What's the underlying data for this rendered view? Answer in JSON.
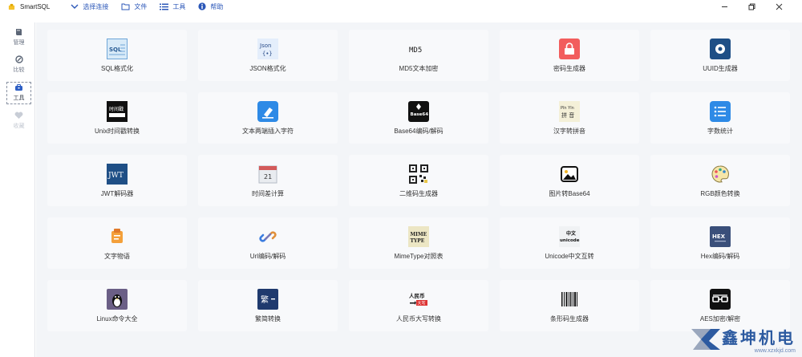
{
  "titlebar": {
    "app_title": "SmartSQL",
    "menu": [
      {
        "label": "选择连接",
        "icon": "chevron-down-icon"
      },
      {
        "label": "文件",
        "icon": "folder-icon"
      },
      {
        "label": "工具",
        "icon": "list-icon"
      },
      {
        "label": "帮助",
        "icon": "info-icon"
      }
    ],
    "controls": [
      "minimize",
      "maximize",
      "close"
    ]
  },
  "sidebar": {
    "items": [
      {
        "label": "管理",
        "icon": "book-icon",
        "state": "normal"
      },
      {
        "label": "比较",
        "icon": "compare-icon",
        "state": "normal"
      },
      {
        "label": "工具",
        "icon": "toolbox-icon",
        "state": "active"
      },
      {
        "label": "收藏",
        "icon": "heart-icon",
        "state": "disabled"
      }
    ]
  },
  "tools": [
    {
      "label": "SQL格式化",
      "icon": "sql-icon"
    },
    {
      "label": "JSON格式化",
      "icon": "json-icon"
    },
    {
      "label": "MD5文本加密",
      "icon": "md5-icon"
    },
    {
      "label": "密码生成器",
      "icon": "password-icon"
    },
    {
      "label": "UUID生成器",
      "icon": "uuid-icon"
    },
    {
      "label": "Unix时间戳转换",
      "icon": "timestamp-icon"
    },
    {
      "label": "文本两端插入字符",
      "icon": "text-insert-icon"
    },
    {
      "label": "Base64编码/解码",
      "icon": "base64-icon"
    },
    {
      "label": "汉字转拼音",
      "icon": "pinyin-icon"
    },
    {
      "label": "字数统计",
      "icon": "word-count-icon"
    },
    {
      "label": "JWT解码器",
      "icon": "jwt-icon"
    },
    {
      "label": "时间差计算",
      "icon": "calendar-icon"
    },
    {
      "label": "二维码生成器",
      "icon": "qrcode-icon"
    },
    {
      "label": "图片转Base64",
      "icon": "image-icon"
    },
    {
      "label": "RGB颜色转换",
      "icon": "palette-icon"
    },
    {
      "label": "文字物语",
      "icon": "text-story-icon"
    },
    {
      "label": "Url编码/解码",
      "icon": "link-icon"
    },
    {
      "label": "MimeType对照表",
      "icon": "mimetype-icon"
    },
    {
      "label": "Unicode中文互转",
      "icon": "unicode-icon"
    },
    {
      "label": "Hex编码/解码",
      "icon": "hex-icon"
    },
    {
      "label": "Linux命令大全",
      "icon": "linux-icon"
    },
    {
      "label": "繁简转换",
      "icon": "traditional-simplified-icon"
    },
    {
      "label": "人民币大写转换",
      "icon": "rmb-icon"
    },
    {
      "label": "条形码生成器",
      "icon": "barcode-icon"
    },
    {
      "label": "AES加密/解密",
      "icon": "aes-icon"
    }
  ],
  "icon_text": {
    "sql": "SQL",
    "json": "Json",
    "md5": "MD5",
    "timestamp": "时间戳",
    "base64": "Base64",
    "pinyin_top": "Pīn Yīn",
    "pinyin_bottom": "拼 音",
    "jwt": "JWT",
    "calendar_day": "21",
    "mime_top": "MIME",
    "mime_bottom": "TYPE",
    "unicode_top": "中文",
    "unicode_bottom": "unicode",
    "hex": "HEX",
    "traditional": "繁",
    "rmb_top": "人民币",
    "rmb_bottom": "大写"
  },
  "watermark": {
    "brand": "鑫坤机电",
    "url": "www.xzxkjd.com"
  },
  "colors": {
    "accent": "#2b57b8",
    "main_bg": "#f3f5f8",
    "card_bg": "#f8f9fb"
  }
}
